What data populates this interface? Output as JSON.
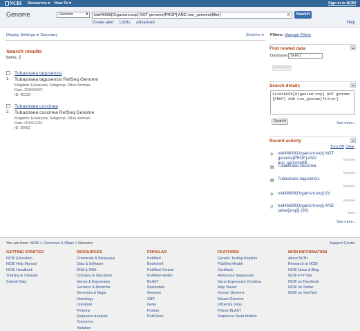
{
  "header": {
    "logo": "NCBI",
    "resources": "Resources ▾",
    "howto": "How To ▾",
    "signin": "Sign in to NCBI"
  },
  "search": {
    "db_title": "Genome",
    "db_selected": "Genome",
    "query": "txid46699[Organism:exp] NOT genome[PROP] AND non_genome[filter]",
    "button": "Search",
    "links": [
      "Create alert",
      "Limits",
      "Advanced"
    ],
    "help": "Help"
  },
  "subheader": {
    "display_settings": "Display Settings: ▸ Summary",
    "send_to": "Send to: ▸",
    "filters_label": "Filters:",
    "filters_link": "Manage Filters"
  },
  "results": {
    "title": "Search results",
    "count": "Items: 2",
    "items": [
      {
        "num": "1.",
        "title": "Tubastraea tagusensis",
        "desc": "Tubastraea tagusensis RefSeq Genome",
        "kingdom": "Kingdom: Eukaryota;   Subgroup: Other Animals",
        "date": "Date: 2016/06/07",
        "id": "ID: 45229"
      },
      {
        "num": "2.",
        "title": "Tubastraea coccinea",
        "desc": "Tubastraea coccinea RefSeq Genome",
        "kingdom": "Kingdom: Eukaryota;   Subgroup: Other Animals",
        "date": "Date: 2014/12/31",
        "id": "ID: 35662"
      }
    ]
  },
  "sidebar": {
    "find_related": {
      "title": "Find related data",
      "db_label": "Database:",
      "db_value": "Select",
      "button": "Find items"
    },
    "search_details": {
      "title": "Search details",
      "text": "txid46699[Organism:exp] NOT genome[PROP] AND non_genome[filter]",
      "button": "Search",
      "see_more": "See more..."
    },
    "recent_activity": {
      "title": "Recent activity",
      "turn_off": "Turn Off",
      "clear": "Clear",
      "items": [
        {
          "icon": "search-icon",
          "text": "txid46699[Organism:exp] NOT genome[PROP] AND non_genome[filt",
          "type": "Genome"
        },
        {
          "icon": "document-icon",
          "text": "Tubastraea coccinea",
          "type": "Genome"
        },
        {
          "icon": "document-icon",
          "text": "Tubastraea tagusensis",
          "type": "Genome"
        },
        {
          "icon": "search-icon",
          "text": "txid46699[Organism:exp] (0)",
          "type": "Genome"
        },
        {
          "icon": "search-icon",
          "text": "txid46699[Organism:exp] AND (alive[prop]) (30)",
          "type": "Geno"
        }
      ],
      "see_more": "See more..."
    }
  },
  "footer": {
    "breadcrumb_prefix": "You are here:",
    "breadcrumb": [
      "NCBI",
      "Genomes & Maps",
      "Genome"
    ],
    "support": "Support Center",
    "columns": [
      {
        "head": "GETTING STARTED",
        "items": [
          "NCBI Education",
          "NCBI Help Manual",
          "NCBI Handbook",
          "Training & Tutorials",
          "Submit Data"
        ]
      },
      {
        "head": "RESOURCES",
        "items": [
          "Chemicals & Bioassays",
          "Data & Software",
          "DNA & RNA",
          "Domains & Structures",
          "Genes & Expression",
          "Genetics & Medicine",
          "Genomes & Maps",
          "Homology",
          "Literature",
          "Proteins",
          "Sequence Analysis",
          "Taxonomy",
          "Variation"
        ]
      },
      {
        "head": "POPULAR",
        "items": [
          "PubMed",
          "Bookshelf",
          "PubMed Central",
          "PubMed Health",
          "BLAST",
          "Nucleotide",
          "Genome",
          "SNP",
          "Gene",
          "Protein",
          "PubChem"
        ]
      },
      {
        "head": "FEATURED",
        "items": [
          "Genetic Testing Registry",
          "PubMed Health",
          "GenBank",
          "Reference Sequences",
          "Gene Expression Omnibus",
          "Map Viewer",
          "Human Genome",
          "Mouse Genome",
          "Influenza Virus",
          "Primer-BLAST",
          "Sequence Read Archive"
        ]
      },
      {
        "head": "NCBI INFORMATION",
        "items": [
          "About NCBI",
          "Research at NCBI",
          "NCBI News & Blog",
          "NCBI FTP Site",
          "NCBI on Facebook",
          "NCBI on Twitter",
          "NCBI on YouTube"
        ]
      }
    ]
  }
}
